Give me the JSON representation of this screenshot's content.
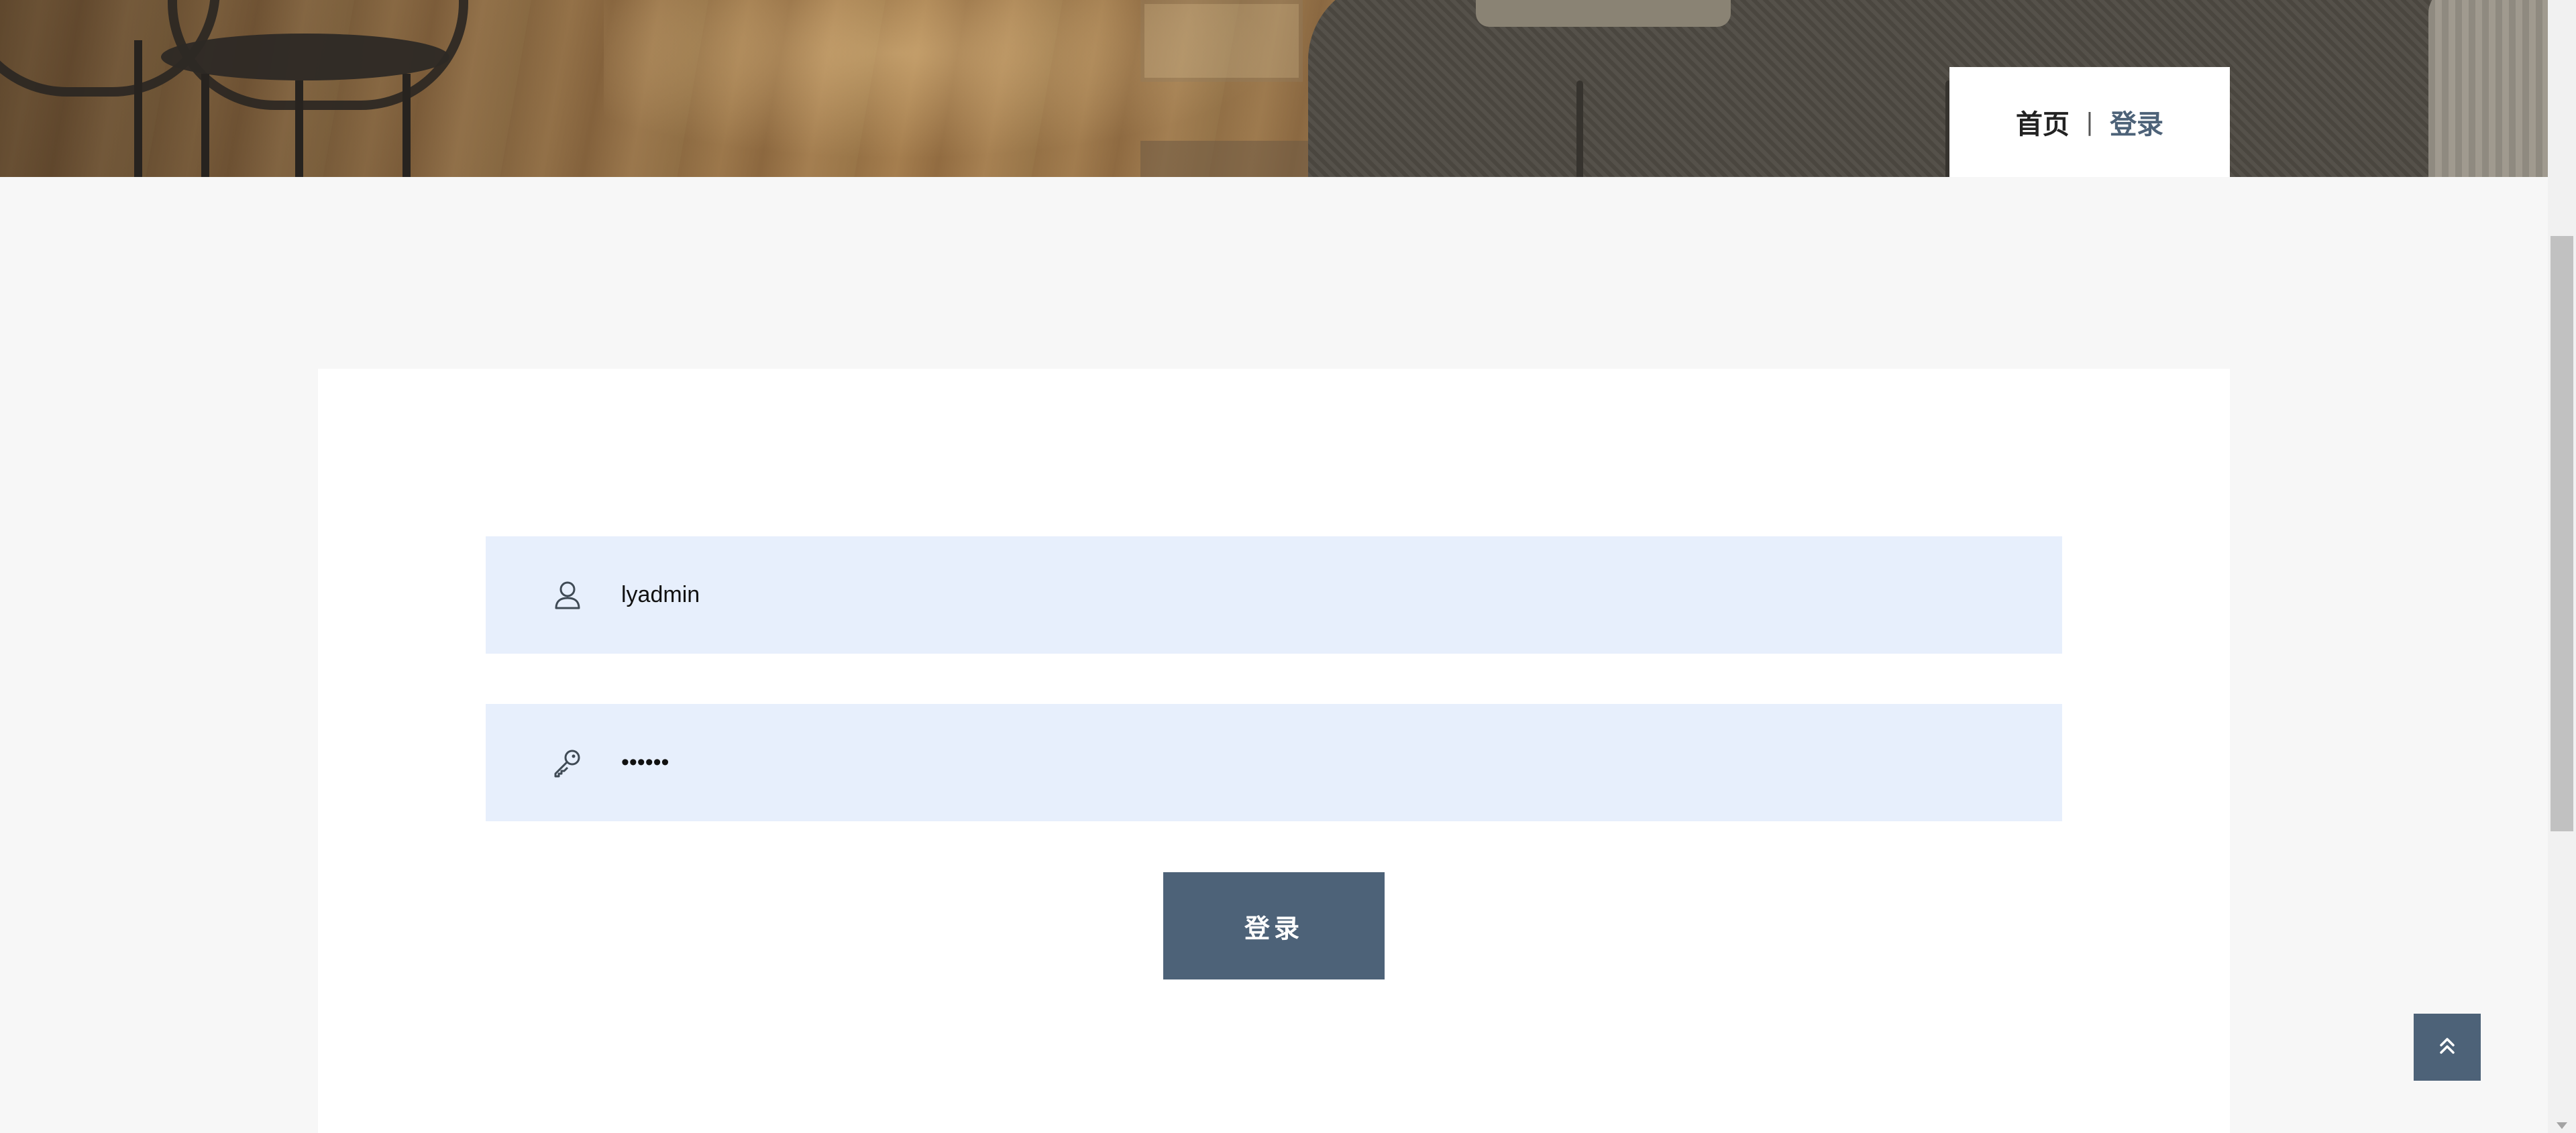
{
  "breadcrumb": {
    "home": "首页",
    "separator": "|",
    "current": "登录"
  },
  "login_form": {
    "username": {
      "icon": "user-icon",
      "value": "lyadmin"
    },
    "password": {
      "icon": "key-icon",
      "value": "123456"
    },
    "submit_label": "登录"
  },
  "back_to_top": {
    "icon": "double-chevron-up-icon"
  },
  "colors": {
    "accent": "#4d6278",
    "field_background": "#e7effc",
    "page_background": "#f7f7f7",
    "card_background": "#ffffff"
  }
}
